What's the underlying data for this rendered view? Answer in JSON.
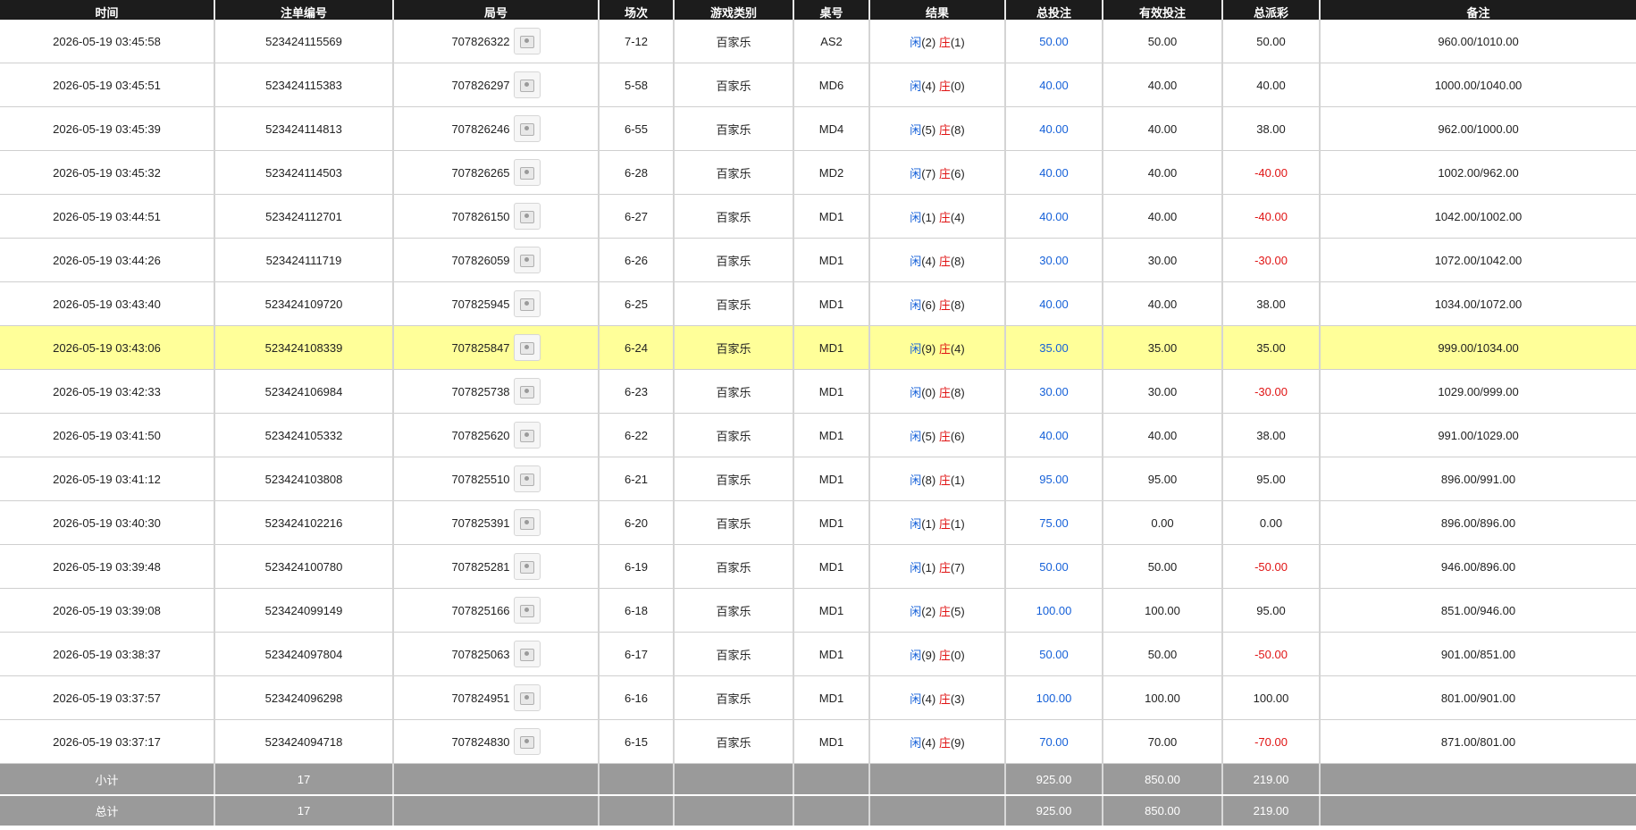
{
  "columns": [
    "时间",
    "注单编号",
    "局号",
    "场次",
    "游戏类别",
    "桌号",
    "结果",
    "总投注",
    "有效投注",
    "总派彩",
    "备注"
  ],
  "rows": [
    {
      "time": "2026-05-19 03:45:58",
      "bet_id": "523424115569",
      "round": "707826322",
      "shoe": "7-12",
      "game": "百家乐",
      "table": "AS2",
      "p_label": "闲",
      "p": "(2)",
      "b_label": "庄",
      "b": "(1)",
      "total_bet": "50.00",
      "valid_bet": "50.00",
      "payout": "50.00",
      "payout_neg": false,
      "note": "960.00/1010.00",
      "highlight": false
    },
    {
      "time": "2026-05-19 03:45:51",
      "bet_id": "523424115383",
      "round": "707826297",
      "shoe": "5-58",
      "game": "百家乐",
      "table": "MD6",
      "p_label": "闲",
      "p": "(4)",
      "b_label": "庄",
      "b": "(0)",
      "total_bet": "40.00",
      "valid_bet": "40.00",
      "payout": "40.00",
      "payout_neg": false,
      "note": "1000.00/1040.00",
      "highlight": false
    },
    {
      "time": "2026-05-19 03:45:39",
      "bet_id": "523424114813",
      "round": "707826246",
      "shoe": "6-55",
      "game": "百家乐",
      "table": "MD4",
      "p_label": "闲",
      "p": "(5)",
      "b_label": "庄",
      "b": "(8)",
      "total_bet": "40.00",
      "valid_bet": "40.00",
      "payout": "38.00",
      "payout_neg": false,
      "note": "962.00/1000.00",
      "highlight": false
    },
    {
      "time": "2026-05-19 03:45:32",
      "bet_id": "523424114503",
      "round": "707826265",
      "shoe": "6-28",
      "game": "百家乐",
      "table": "MD2",
      "p_label": "闲",
      "p": "(7)",
      "b_label": "庄",
      "b": "(6)",
      "total_bet": "40.00",
      "valid_bet": "40.00",
      "payout": "-40.00",
      "payout_neg": true,
      "note": "1002.00/962.00",
      "highlight": false
    },
    {
      "time": "2026-05-19 03:44:51",
      "bet_id": "523424112701",
      "round": "707826150",
      "shoe": "6-27",
      "game": "百家乐",
      "table": "MD1",
      "p_label": "闲",
      "p": "(1)",
      "b_label": "庄",
      "b": "(4)",
      "total_bet": "40.00",
      "valid_bet": "40.00",
      "payout": "-40.00",
      "payout_neg": true,
      "note": "1042.00/1002.00",
      "highlight": false
    },
    {
      "time": "2026-05-19 03:44:26",
      "bet_id": "523424111719",
      "round": "707826059",
      "shoe": "6-26",
      "game": "百家乐",
      "table": "MD1",
      "p_label": "闲",
      "p": "(4)",
      "b_label": "庄",
      "b": "(8)",
      "total_bet": "30.00",
      "valid_bet": "30.00",
      "payout": "-30.00",
      "payout_neg": true,
      "note": "1072.00/1042.00",
      "highlight": false
    },
    {
      "time": "2026-05-19 03:43:40",
      "bet_id": "523424109720",
      "round": "707825945",
      "shoe": "6-25",
      "game": "百家乐",
      "table": "MD1",
      "p_label": "闲",
      "p": "(6)",
      "b_label": "庄",
      "b": "(8)",
      "total_bet": "40.00",
      "valid_bet": "40.00",
      "payout": "38.00",
      "payout_neg": false,
      "note": "1034.00/1072.00",
      "highlight": false
    },
    {
      "time": "2026-05-19 03:43:06",
      "bet_id": "523424108339",
      "round": "707825847",
      "shoe": "6-24",
      "game": "百家乐",
      "table": "MD1",
      "p_label": "闲",
      "p": "(9)",
      "b_label": "庄",
      "b": "(4)",
      "total_bet": "35.00",
      "valid_bet": "35.00",
      "payout": "35.00",
      "payout_neg": false,
      "note": "999.00/1034.00",
      "highlight": true
    },
    {
      "time": "2026-05-19 03:42:33",
      "bet_id": "523424106984",
      "round": "707825738",
      "shoe": "6-23",
      "game": "百家乐",
      "table": "MD1",
      "p_label": "闲",
      "p": "(0)",
      "b_label": "庄",
      "b": "(8)",
      "total_bet": "30.00",
      "valid_bet": "30.00",
      "payout": "-30.00",
      "payout_neg": true,
      "note": "1029.00/999.00",
      "highlight": false
    },
    {
      "time": "2026-05-19 03:41:50",
      "bet_id": "523424105332",
      "round": "707825620",
      "shoe": "6-22",
      "game": "百家乐",
      "table": "MD1",
      "p_label": "闲",
      "p": "(5)",
      "b_label": "庄",
      "b": "(6)",
      "total_bet": "40.00",
      "valid_bet": "40.00",
      "payout": "38.00",
      "payout_neg": false,
      "note": "991.00/1029.00",
      "highlight": false
    },
    {
      "time": "2026-05-19 03:41:12",
      "bet_id": "523424103808",
      "round": "707825510",
      "shoe": "6-21",
      "game": "百家乐",
      "table": "MD1",
      "p_label": "闲",
      "p": "(8)",
      "b_label": "庄",
      "b": "(1)",
      "total_bet": "95.00",
      "valid_bet": "95.00",
      "payout": "95.00",
      "payout_neg": false,
      "note": "896.00/991.00",
      "highlight": false
    },
    {
      "time": "2026-05-19 03:40:30",
      "bet_id": "523424102216",
      "round": "707825391",
      "shoe": "6-20",
      "game": "百家乐",
      "table": "MD1",
      "p_label": "闲",
      "p": "(1)",
      "b_label": "庄",
      "b": "(1)",
      "total_bet": "75.00",
      "valid_bet": "0.00",
      "payout": "0.00",
      "payout_neg": false,
      "note": "896.00/896.00",
      "highlight": false
    },
    {
      "time": "2026-05-19 03:39:48",
      "bet_id": "523424100780",
      "round": "707825281",
      "shoe": "6-19",
      "game": "百家乐",
      "table": "MD1",
      "p_label": "闲",
      "p": "(1)",
      "b_label": "庄",
      "b": "(7)",
      "total_bet": "50.00",
      "valid_bet": "50.00",
      "payout": "-50.00",
      "payout_neg": true,
      "note": "946.00/896.00",
      "highlight": false
    },
    {
      "time": "2026-05-19 03:39:08",
      "bet_id": "523424099149",
      "round": "707825166",
      "shoe": "6-18",
      "game": "百家乐",
      "table": "MD1",
      "p_label": "闲",
      "p": "(2)",
      "b_label": "庄",
      "b": "(5)",
      "total_bet": "100.00",
      "valid_bet": "100.00",
      "payout": "95.00",
      "payout_neg": false,
      "note": "851.00/946.00",
      "highlight": false
    },
    {
      "time": "2026-05-19 03:38:37",
      "bet_id": "523424097804",
      "round": "707825063",
      "shoe": "6-17",
      "game": "百家乐",
      "table": "MD1",
      "p_label": "闲",
      "p": "(9)",
      "b_label": "庄",
      "b": "(0)",
      "total_bet": "50.00",
      "valid_bet": "50.00",
      "payout": "-50.00",
      "payout_neg": true,
      "note": "901.00/851.00",
      "highlight": false
    },
    {
      "time": "2026-05-19 03:37:57",
      "bet_id": "523424096298",
      "round": "707824951",
      "shoe": "6-16",
      "game": "百家乐",
      "table": "MD1",
      "p_label": "闲",
      "p": "(4)",
      "b_label": "庄",
      "b": "(3)",
      "total_bet": "100.00",
      "valid_bet": "100.00",
      "payout": "100.00",
      "payout_neg": false,
      "note": "801.00/901.00",
      "highlight": false
    },
    {
      "time": "2026-05-19 03:37:17",
      "bet_id": "523424094718",
      "round": "707824830",
      "shoe": "6-15",
      "game": "百家乐",
      "table": "MD1",
      "p_label": "闲",
      "p": "(4)",
      "b_label": "庄",
      "b": "(9)",
      "total_bet": "70.00",
      "valid_bet": "70.00",
      "payout": "-70.00",
      "payout_neg": true,
      "note": "871.00/801.00",
      "highlight": false
    }
  ],
  "subtotal": {
    "label": "小计",
    "count": "17",
    "total_bet": "925.00",
    "valid_bet": "850.00",
    "payout": "219.00"
  },
  "total": {
    "label": "总计",
    "count": "17",
    "total_bet": "925.00",
    "valid_bet": "850.00",
    "payout": "219.00"
  },
  "colors": {
    "header_bg": "#1c1c1c",
    "highlight_row": "#ffff99",
    "footer_bg": "#9a9a9a",
    "blue": "#1560d8",
    "red": "#e01414"
  },
  "icons": {
    "round_video": "video-replay-icon"
  }
}
